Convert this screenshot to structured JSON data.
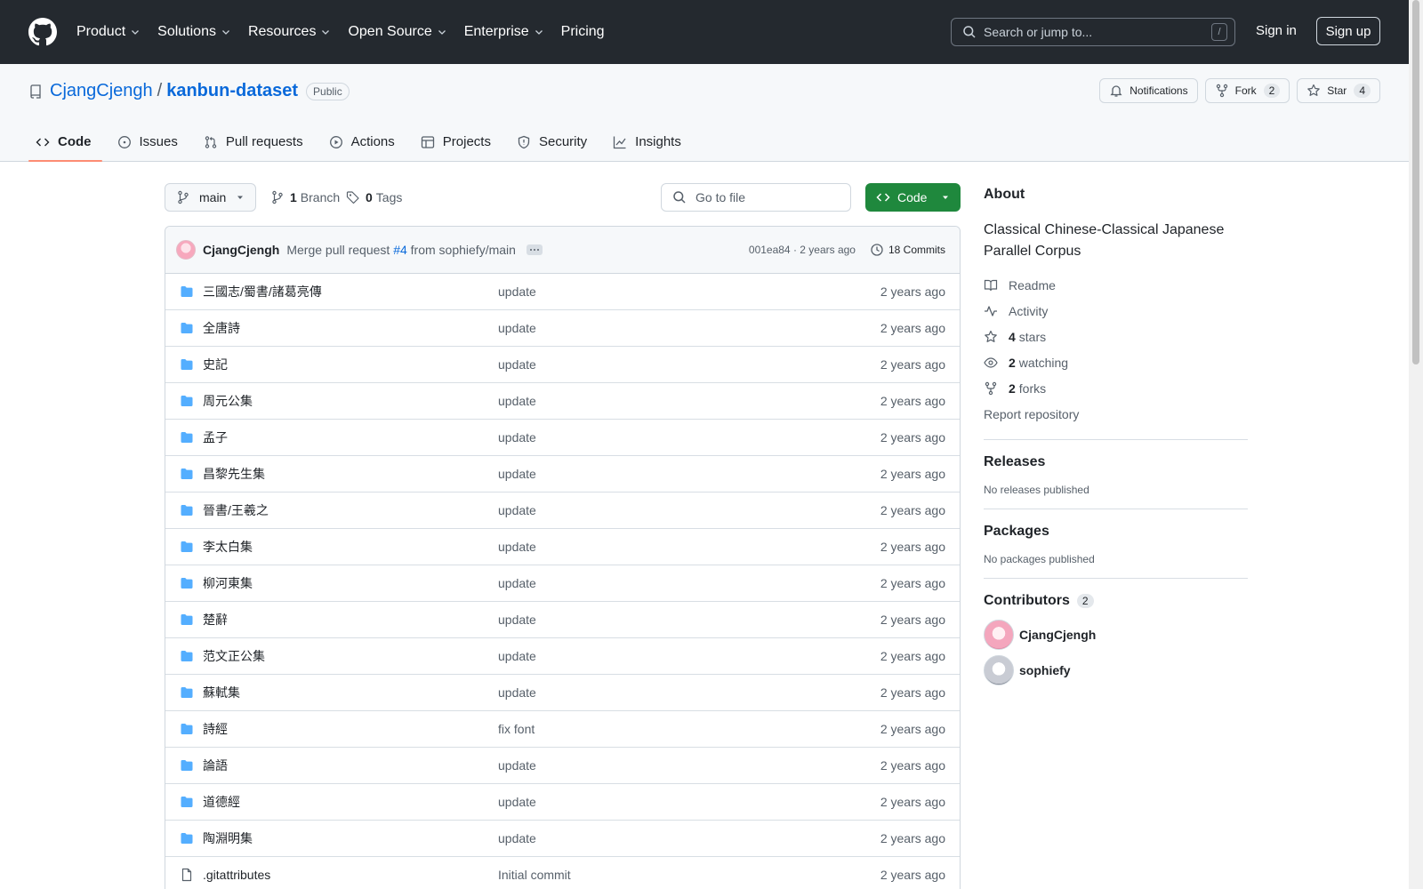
{
  "header": {
    "nav": [
      "Product",
      "Solutions",
      "Resources",
      "Open Source",
      "Enterprise",
      "Pricing"
    ],
    "search_placeholder": "Search or jump to...",
    "search_shortcut": "/",
    "signin": "Sign in",
    "signup": "Sign up"
  },
  "repo": {
    "owner": "CjangCjengh",
    "separator": "/",
    "name": "kanbun-dataset",
    "visibility": "Public",
    "notifications_label": "Notifications",
    "fork_label": "Fork",
    "fork_count": "2",
    "star_label": "Star",
    "star_count": "4"
  },
  "tabs": [
    "Code",
    "Issues",
    "Pull requests",
    "Actions",
    "Projects",
    "Security",
    "Insights"
  ],
  "toolbar": {
    "branch": "main",
    "branch_count": "1",
    "branch_label": "Branch",
    "tag_count": "0",
    "tag_label": "Tags",
    "goto_placeholder": "Go to file",
    "code_label": "Code"
  },
  "commit": {
    "author": "CjangCjengh",
    "msg_prefix": "Merge pull request",
    "pr": "#4",
    "msg_suffix": "from sophiefy/main",
    "hash_time": "001ea84 · 2 years ago",
    "commits_label": "18 Commits"
  },
  "files": [
    {
      "name": "三國志/蜀書/諸葛亮傳",
      "msg": "update",
      "date": "2 years ago",
      "type": "dir"
    },
    {
      "name": "全唐詩",
      "msg": "update",
      "date": "2 years ago",
      "type": "dir"
    },
    {
      "name": "史記",
      "msg": "update",
      "date": "2 years ago",
      "type": "dir"
    },
    {
      "name": "周元公集",
      "msg": "update",
      "date": "2 years ago",
      "type": "dir"
    },
    {
      "name": "孟子",
      "msg": "update",
      "date": "2 years ago",
      "type": "dir"
    },
    {
      "name": "昌黎先生集",
      "msg": "update",
      "date": "2 years ago",
      "type": "dir"
    },
    {
      "name": "晉書/王羲之",
      "msg": "update",
      "date": "2 years ago",
      "type": "dir"
    },
    {
      "name": "李太白集",
      "msg": "update",
      "date": "2 years ago",
      "type": "dir"
    },
    {
      "name": "柳河東集",
      "msg": "update",
      "date": "2 years ago",
      "type": "dir"
    },
    {
      "name": "楚辭",
      "msg": "update",
      "date": "2 years ago",
      "type": "dir"
    },
    {
      "name": "范文正公集",
      "msg": "update",
      "date": "2 years ago",
      "type": "dir"
    },
    {
      "name": "蘇軾集",
      "msg": "update",
      "date": "2 years ago",
      "type": "dir"
    },
    {
      "name": "詩經",
      "msg": "fix font",
      "date": "2 years ago",
      "type": "dir"
    },
    {
      "name": "論語",
      "msg": "update",
      "date": "2 years ago",
      "type": "dir"
    },
    {
      "name": "道德經",
      "msg": "update",
      "date": "2 years ago",
      "type": "dir"
    },
    {
      "name": "陶淵明集",
      "msg": "update",
      "date": "2 years ago",
      "type": "dir"
    },
    {
      "name": ".gitattributes",
      "msg": "Initial commit",
      "date": "2 years ago",
      "type": "file"
    }
  ],
  "about": {
    "title": "About",
    "description": "Classical Chinese-Classical Japanese Parallel Corpus",
    "readme": "Readme",
    "activity": "Activity",
    "stars_count": "4",
    "stars_label": "stars",
    "watching_count": "2",
    "watching_label": "watching",
    "forks_count": "2",
    "forks_label": "forks",
    "report": "Report repository"
  },
  "releases": {
    "title": "Releases",
    "note": "No releases published"
  },
  "packages": {
    "title": "Packages",
    "note": "No packages published"
  },
  "contributors": {
    "title": "Contributors",
    "count": "2",
    "people": [
      "CjangCjengh",
      "sophiefy"
    ]
  },
  "colors": {
    "header_bg": "#24292f",
    "link": "#0969da",
    "primary_button": "#1f883d",
    "active_tab_underline": "#fd8c73",
    "folder_icon": "#54aeff"
  }
}
